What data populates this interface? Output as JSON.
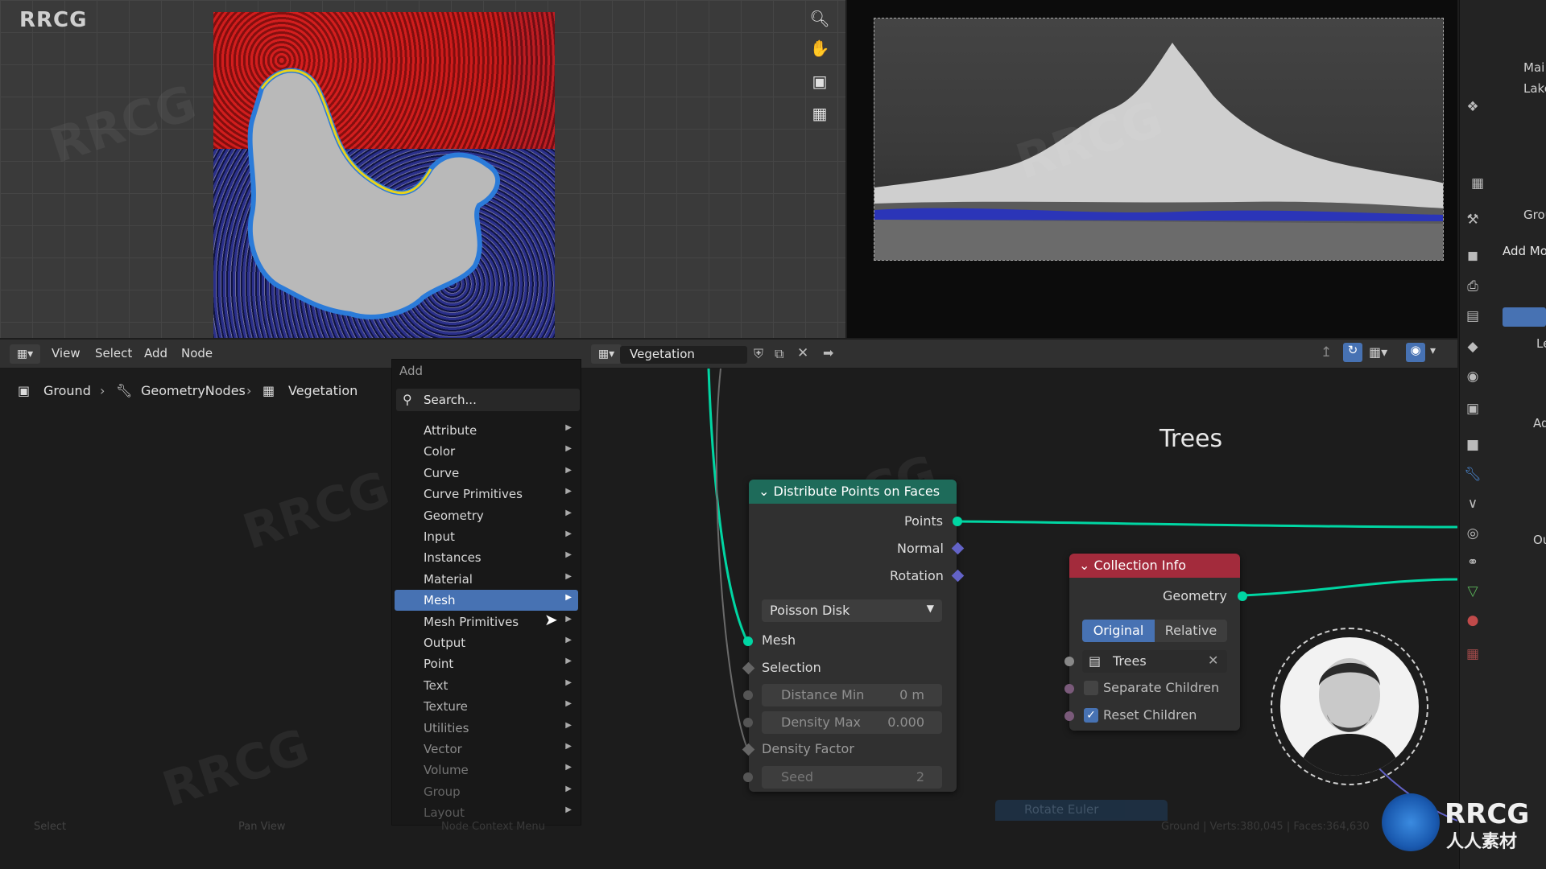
{
  "viewport": {
    "watermark_label": "RRCG"
  },
  "node_editor": {
    "menus": [
      "View",
      "Select",
      "Add",
      "Node"
    ],
    "node_tree_name": "Vegetation",
    "breadcrumb": [
      "Ground",
      "GeometryNodes",
      "Vegetation"
    ]
  },
  "add_menu": {
    "title": "Add",
    "search_placeholder": "Search...",
    "items": [
      "Attribute",
      "Color",
      "Curve",
      "Curve Primitives",
      "Geometry",
      "Input",
      "Instances",
      "Material",
      "Mesh",
      "Mesh Primitives",
      "Output",
      "Point",
      "Text",
      "Texture",
      "Utilities",
      "Vector",
      "Volume",
      "Group",
      "Layout"
    ],
    "active_item": "Mesh"
  },
  "frame": {
    "label": "Trees"
  },
  "distribute_node": {
    "title": "Distribute Points on Faces",
    "outputs": [
      "Points",
      "Normal",
      "Rotation"
    ],
    "mode": "Poisson Disk",
    "inputs": {
      "mesh": "Mesh",
      "selection": "Selection",
      "distance_min_label": "Distance Min",
      "distance_min_value": "0 m",
      "density_max_label": "Density Max",
      "density_max_value": "0.000",
      "density_factor": "Density Factor",
      "seed_label": "Seed",
      "seed_value": "2"
    }
  },
  "collection_node": {
    "title": "Collection Info",
    "output": "Geometry",
    "transform_options": [
      "Original",
      "Relative"
    ],
    "active_option": "Original",
    "collection": "Trees",
    "separate_children": "Separate Children",
    "reset_children": "Reset Children",
    "reset_children_checked": true,
    "separate_children_checked": false
  },
  "bottom_node_hint": "Rotate Euler",
  "status_bar": {
    "select": "Select",
    "pan": "Pan View",
    "context": "Node Context Menu",
    "stats": "Ground | Verts:380,045 | Faces:364,630"
  },
  "right_panel": {
    "outliner_items": [
      "Mai",
      "Lake"
    ],
    "properties": [
      "Grou",
      "Add Mo",
      "Le",
      "Ad",
      "Ou"
    ]
  },
  "logo": {
    "text_top": "RRCG",
    "text_bottom": "人人素材"
  },
  "colors": {
    "accent_blue": "#4772b3",
    "distribute_header": "#1e6b5a",
    "collection_header": "#a32b3c",
    "geometry_socket": "#00d6a3",
    "vector_socket": "#6363c7"
  }
}
